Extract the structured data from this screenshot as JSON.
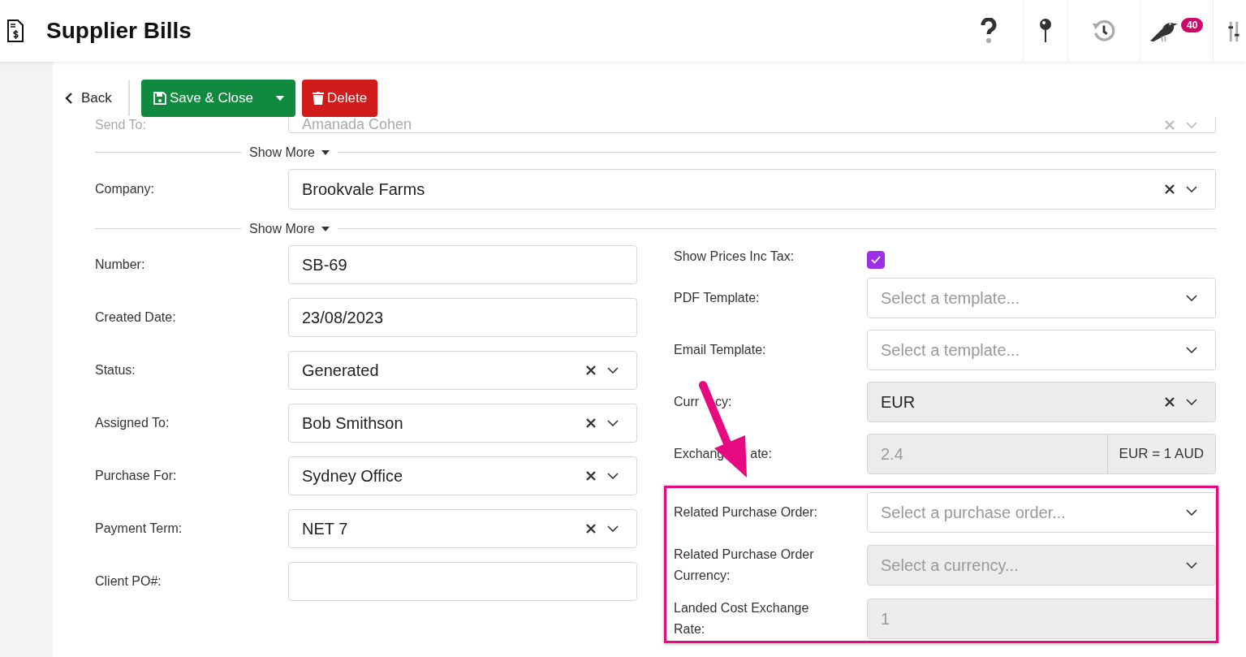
{
  "header": {
    "title": "Supplier Bills",
    "notifications": "40"
  },
  "toolbar": {
    "back": "Back",
    "save": "Save & Close",
    "delete": "Delete"
  },
  "send_to": {
    "label": "Send To:",
    "value": "Amanada Cohen"
  },
  "company": {
    "show_more": "Show More",
    "label": "Company:",
    "value": "Brookvale Farms"
  },
  "details_show_more": "Show More",
  "left_fields": [
    {
      "label": "Number:",
      "kind": "text",
      "value": "SB-69"
    },
    {
      "label": "Created Date:",
      "kind": "text",
      "value": "23/08/2023"
    },
    {
      "label": "Status:",
      "kind": "select",
      "value": "Generated"
    },
    {
      "label": "Assigned To:",
      "kind": "select",
      "value": "Bob Smithson"
    },
    {
      "label": "Purchase For:",
      "kind": "select",
      "value": "Sydney Office"
    },
    {
      "label": "Payment Term:",
      "kind": "select",
      "value": "NET 7"
    },
    {
      "label": "Client PO#:",
      "kind": "text"
    }
  ],
  "right_fields": [
    {
      "label": "Show Prices Inc Tax:",
      "kind": "checkbox",
      "checked": true
    },
    {
      "label": "PDF Template:",
      "kind": "select",
      "placeholder": "Select a template...",
      "disabled": false
    },
    {
      "label": "Email Template:",
      "kind": "select",
      "placeholder": "Select a template...",
      "disabled": false
    },
    {
      "label_parts": [
        "Curr",
        "cy:"
      ],
      "kind": "select",
      "value": "EUR",
      "disabled": true
    },
    {
      "label_parts": [
        "Exchang",
        "ate:"
      ],
      "kind": "addon",
      "value": "2.4",
      "addon": "EUR = 1 AUD",
      "disabled": true
    }
  ],
  "highlighted_fields": [
    {
      "label": "Related Purchase Order:",
      "kind": "select",
      "placeholder": "Select a purchase order...",
      "disabled": false
    },
    {
      "label": "Related Purchase Order Currency:",
      "kind": "select",
      "placeholder": "Select a currency...",
      "disabled": true
    },
    {
      "label": "Landed Cost Exchange Rate:",
      "kind": "text",
      "value": "1",
      "disabled": true
    }
  ]
}
